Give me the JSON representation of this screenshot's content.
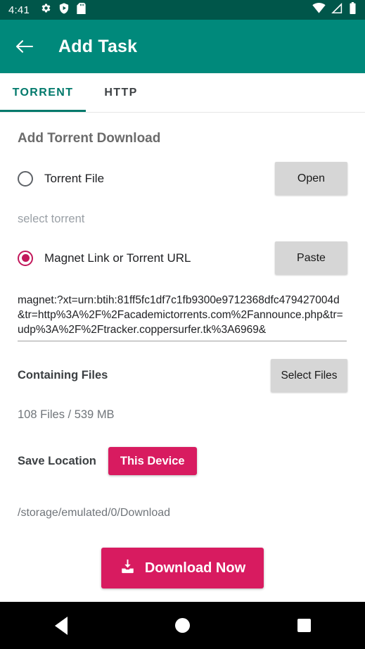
{
  "statusbar": {
    "time": "4:41",
    "left_icons": [
      "gear-icon",
      "shield-play-icon",
      "sd-card-icon"
    ],
    "right_icons": [
      "wifi-icon",
      "cell-signal-icon",
      "battery-icon"
    ],
    "background_color": "#00564a"
  },
  "appbar": {
    "back_icon": "arrow-left-icon",
    "title": "Add Task",
    "background_color": "#00897b"
  },
  "tabs": {
    "items": [
      {
        "label": "TORRENT",
        "active": true
      },
      {
        "label": "HTTP",
        "active": false
      }
    ],
    "active_color": "#00796b",
    "inactive_color": "#3c4043"
  },
  "form": {
    "section_title": "Add Torrent Download",
    "torrent_file": {
      "radio_label": "Torrent File",
      "selected": false,
      "button_label": "Open",
      "placeholder": "select torrent"
    },
    "magnet": {
      "radio_label": "Magnet Link or Torrent URL",
      "selected": true,
      "button_label": "Paste",
      "value": "magnet:?xt=urn:btih:81ff5fc1df7c1fb9300e9712368dfc479427004d&tr=http%3A%2F%2Facademictorrents.com%2Fannounce.php&tr=udp%3A%2F%2Ftracker.coppersurfer.tk%3A6969&"
    },
    "containing_files": {
      "label": "Containing Files",
      "button_label": "Select Files",
      "summary": "108 Files / 539 MB"
    },
    "save_location": {
      "label": "Save Location",
      "button_label": "This Device",
      "path": "/storage/emulated/0/Download"
    },
    "download_button": {
      "label": "Download Now",
      "icon": "download-tray-icon"
    },
    "accent_color": "#d81b60",
    "radio_color": "#c2185b"
  },
  "navbar": {
    "back_label": "back-button",
    "home_label": "home-button",
    "recents_label": "recents-button"
  }
}
